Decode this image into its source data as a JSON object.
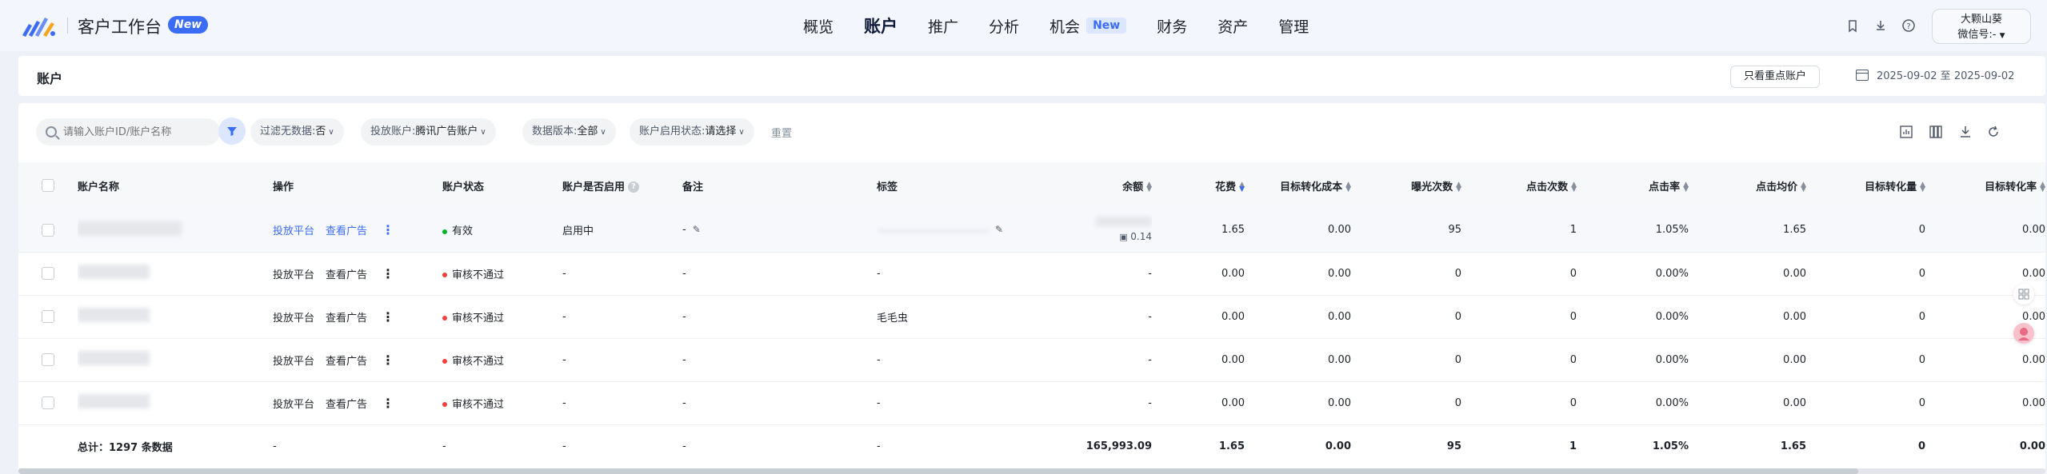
{
  "topbar": {
    "brand": "客户工作台",
    "brand_badge": "New",
    "nav": [
      {
        "label": "概览",
        "active": false
      },
      {
        "label": "账户",
        "active": true
      },
      {
        "label": "推广",
        "active": false
      },
      {
        "label": "分析",
        "active": false
      },
      {
        "label": "机会",
        "active": false,
        "badge": "New"
      },
      {
        "label": "财务",
        "active": false
      },
      {
        "label": "资产",
        "active": false
      },
      {
        "label": "管理",
        "active": false
      }
    ],
    "icons": [
      "bookmark-icon",
      "download-icon",
      "help-icon"
    ],
    "user_name": "大颗山葵",
    "user_wechat": "微信号:-"
  },
  "header": {
    "title": "账户",
    "focus_button": "只看重点账户",
    "date_range": "2025-09-02 至 2025-09-02"
  },
  "filters": {
    "search_placeholder": "请输入账户ID/账户名称",
    "chips": [
      {
        "label": "过滤无数据:",
        "value": "否"
      },
      {
        "label": "投放账户:",
        "value": "腾讯广告账户"
      },
      {
        "label": "数据版本:",
        "value": "全部"
      },
      {
        "label": "账户启用状态:",
        "value": "请选择"
      }
    ],
    "reset": "重置",
    "tools": [
      "chart-icon",
      "columns-icon",
      "download-icon",
      "refresh-icon"
    ]
  },
  "table": {
    "headers": {
      "name": "账户名称",
      "ops": "操作",
      "status": "账户状态",
      "enabled": "账户是否启用",
      "note": "备注",
      "tag": "标签",
      "balance": "余额",
      "cost": "花费",
      "target_cost": "目标转化成本",
      "impressions": "曝光次数",
      "clicks": "点击次数",
      "ctr": "点击率",
      "cpc": "点击均价",
      "conversions": "目标转化量",
      "conv_rate": "目标转化率"
    },
    "ops_labels": {
      "platform": "投放平台",
      "ads": "查看广告"
    },
    "rows": [
      {
        "status": "有效",
        "status_color": "#00b42a",
        "enabled": "启用中",
        "note": "-",
        "tag": "",
        "balance": "",
        "balance_sub": "0.14",
        "cost": "1.65",
        "target_cost": "0.00",
        "impressions": "95",
        "clicks": "1",
        "ctr": "1.05%",
        "cpc": "1.65",
        "conversions": "0",
        "conv_rate": "0.00"
      },
      {
        "status": "审核不通过",
        "status_color": "#f53f3f",
        "enabled": "-",
        "note": "-",
        "tag": "-",
        "balance": "-",
        "balance_sub": "",
        "cost": "0.00",
        "target_cost": "0.00",
        "impressions": "0",
        "clicks": "0",
        "ctr": "0.00%",
        "cpc": "0.00",
        "conversions": "0",
        "conv_rate": "0.00"
      },
      {
        "status": "审核不通过",
        "status_color": "#f53f3f",
        "enabled": "-",
        "note": "-",
        "tag": "毛毛虫",
        "balance": "-",
        "balance_sub": "",
        "cost": "0.00",
        "target_cost": "0.00",
        "impressions": "0",
        "clicks": "0",
        "ctr": "0.00%",
        "cpc": "0.00",
        "conversions": "0",
        "conv_rate": "0.00"
      },
      {
        "status": "审核不通过",
        "status_color": "#f53f3f",
        "enabled": "-",
        "note": "-",
        "tag": "-",
        "balance": "-",
        "balance_sub": "",
        "cost": "0.00",
        "target_cost": "0.00",
        "impressions": "0",
        "clicks": "0",
        "ctr": "0.00%",
        "cpc": "0.00",
        "conversions": "0",
        "conv_rate": "0.00"
      },
      {
        "status": "审核不通过",
        "status_color": "#f53f3f",
        "enabled": "-",
        "note": "-",
        "tag": "-",
        "balance": "-",
        "balance_sub": "",
        "cost": "0.00",
        "target_cost": "0.00",
        "impressions": "0",
        "clicks": "0",
        "ctr": "0.00%",
        "cpc": "0.00",
        "conversions": "0",
        "conv_rate": "0.00"
      }
    ],
    "total": {
      "label": "总计：1297 条数据",
      "ops": "-",
      "status": "-",
      "enabled": "-",
      "note": "-",
      "tag": "-",
      "balance": "165,993.09",
      "cost": "1.65",
      "target_cost": "0.00",
      "impressions": "95",
      "clicks": "1",
      "ctr": "1.05%",
      "cpc": "1.65",
      "conversions": "0",
      "conv_rate": "0.00"
    }
  },
  "colors": {
    "accent": "#3b6cf6",
    "valid": "#00b42a",
    "rejected": "#f53f3f"
  }
}
